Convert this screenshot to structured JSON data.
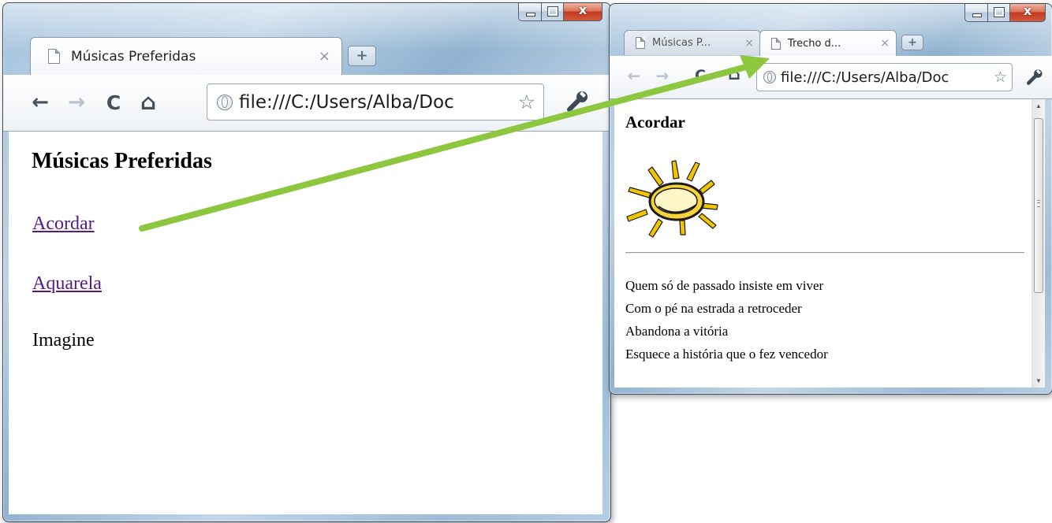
{
  "window_left": {
    "tab": {
      "label": "Músicas Preferidas",
      "close": "×",
      "new_tab": "+"
    },
    "toolbar": {
      "back": "←",
      "forward": "→",
      "reload": "C",
      "home": "⌂",
      "url": "file:///C:/Users/Alba/Doc",
      "bookmark_star": "☆",
      "wrench": "🔧"
    },
    "page": {
      "title": "Músicas Preferidas",
      "links": [
        "Acordar",
        "Aquarela"
      ],
      "text_item": "Imagine"
    }
  },
  "window_right": {
    "tabs": [
      {
        "label": "Músicas P...",
        "close": "×"
      },
      {
        "label": "Trecho d...",
        "close": "×"
      }
    ],
    "new_tab": "+",
    "toolbar": {
      "back": "←",
      "forward": "→",
      "reload": "C",
      "home": "⌂",
      "url": "file:///C:/Users/Alba/Doc",
      "bookmark_star": "☆",
      "wrench": "🔧"
    },
    "page": {
      "title": "Acordar",
      "lyrics": [
        "Quem só de passado insiste em viver",
        "Com o pé na estrada a retroceder",
        "Abandona a vitória",
        "Esquece a história que o fez vencedor"
      ]
    },
    "scrollbar": {
      "up": "▲",
      "down": "▼"
    }
  },
  "colors": {
    "link": "#551a8b",
    "arrow": "#8dc63f",
    "close_button": "#c8452a"
  },
  "icons": [
    "page-icon",
    "globe-icon",
    "star-icon",
    "wrench-icon",
    "sun-image"
  ]
}
